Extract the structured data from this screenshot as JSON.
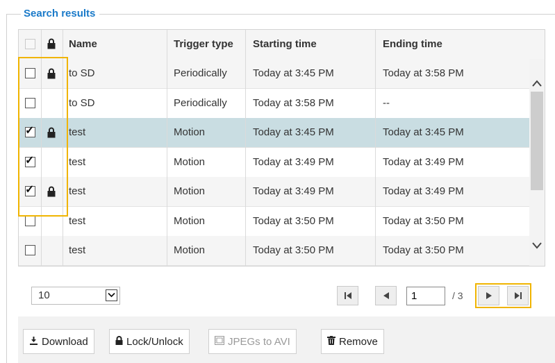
{
  "legend": "Search results",
  "headers": {
    "name": "Name",
    "trigger": "Trigger type",
    "start": "Starting time",
    "end": "Ending time"
  },
  "rows": [
    {
      "checked": false,
      "locked": true,
      "name": "to SD",
      "trigger": "Periodically",
      "start": "Today at 3:45 PM",
      "end": "Today at 3:58 PM"
    },
    {
      "checked": false,
      "locked": false,
      "name": "to SD",
      "trigger": "Periodically",
      "start": "Today at 3:58 PM",
      "end": "--"
    },
    {
      "checked": true,
      "locked": true,
      "name": "test",
      "trigger": "Motion",
      "start": "Today at 3:45 PM",
      "end": "Today at 3:45 PM"
    },
    {
      "checked": true,
      "locked": false,
      "name": "test",
      "trigger": "Motion",
      "start": "Today at 3:49 PM",
      "end": "Today at 3:49 PM"
    },
    {
      "checked": true,
      "locked": true,
      "name": "test",
      "trigger": "Motion",
      "start": "Today at 3:49 PM",
      "end": "Today at 3:49 PM"
    },
    {
      "checked": false,
      "locked": false,
      "name": "test",
      "trigger": "Motion",
      "start": "Today at 3:50 PM",
      "end": "Today at 3:50 PM"
    },
    {
      "checked": false,
      "locked": false,
      "name": "test",
      "trigger": "Motion",
      "start": "Today at 3:50 PM",
      "end": "Today at 3:50 PM"
    }
  ],
  "pagination": {
    "per_page": "10",
    "current_page": "1",
    "total_label": "/ 3"
  },
  "buttons": {
    "download": "Download",
    "lock_unlock": "Lock/Unlock",
    "jpegs_to_avi": "JPEGs to AVI",
    "remove": "Remove"
  },
  "colors": {
    "accent": "#1a7ac9",
    "highlight": "#f0b400",
    "selected_row": "#c9dde2"
  }
}
